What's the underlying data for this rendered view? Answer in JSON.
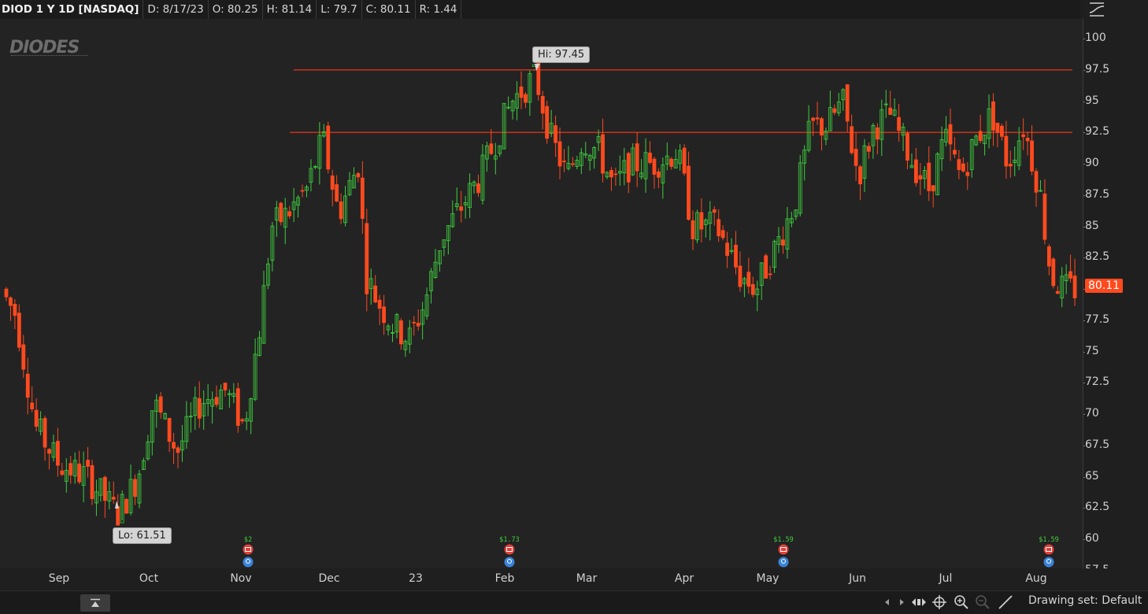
{
  "header": {
    "symbol_label": "DIOD 1 Y 1D [NASDAQ]",
    "date": "D: 8/17/23",
    "open": "O: 80.25",
    "high": "H: 81.14",
    "low": "L: 79.7",
    "close": "C: 80.11",
    "range": "R: 1.44"
  },
  "logo_text": "DIODES",
  "annotations": {
    "high_label": "Hi: 97.45",
    "low_label": "Lo: 61.51"
  },
  "last_price": "80.11",
  "footer": {
    "drawing_set": "Drawing set: Default"
  },
  "icons": [
    "chart-style-icon",
    "collapse-panel-icon",
    "scroll-left-icon",
    "scroll-right-icon",
    "expand-icon",
    "crosshair-icon",
    "zoom-in-icon",
    "zoom-out-icon",
    "drawing-tool-icon",
    "earnings-icon",
    "dividend-icon"
  ],
  "colors": {
    "up": "#3fce3f",
    "down": "#ff4a1e",
    "background": "#232323",
    "resistance_line": "#c8321a"
  },
  "chart_data": {
    "type": "candlestick",
    "title": "DIOD 1 Y 1D [NASDAQ]",
    "x_tick_labels": [
      "Sep",
      "Oct",
      "Nov",
      "Dec",
      "23",
      "Feb",
      "Mar",
      "Apr",
      "May",
      "Jun",
      "Jul",
      "Aug"
    ],
    "y_tick_labels": [
      "100",
      "97.5",
      "95",
      "92.5",
      "90",
      "87.5",
      "85",
      "82.5",
      "80",
      "77.5",
      "75",
      "72.5",
      "70",
      "67.5",
      "65",
      "62.5",
      "60",
      "57.5"
    ],
    "ylim": [
      57.5,
      100
    ],
    "horizontal_lines": [
      97.5,
      92.5
    ],
    "high": 97.45,
    "low": 61.51,
    "last": 80.11,
    "dividend_labels": [
      "$2",
      "$1.73",
      "$1.59",
      "$1.59"
    ],
    "grid": false,
    "series": [
      {
        "name": "Price",
        "approx_close_path": [
          [
            0,
            80
          ],
          [
            20,
            78
          ],
          [
            45,
            69
          ],
          [
            75,
            66
          ],
          [
            110,
            65
          ],
          [
            150,
            62
          ],
          [
            175,
            65
          ],
          [
            195,
            71
          ],
          [
            225,
            67
          ],
          [
            255,
            71
          ],
          [
            285,
            72
          ],
          [
            310,
            69
          ],
          [
            330,
            77
          ],
          [
            345,
            85
          ],
          [
            365,
            86
          ],
          [
            390,
            88
          ],
          [
            410,
            92
          ],
          [
            430,
            86
          ],
          [
            455,
            90
          ],
          [
            465,
            81
          ],
          [
            480,
            79
          ],
          [
            500,
            77
          ],
          [
            520,
            76
          ],
          [
            540,
            79
          ],
          [
            560,
            84
          ],
          [
            580,
            86
          ],
          [
            610,
            89
          ],
          [
            630,
            92
          ],
          [
            650,
            95
          ],
          [
            680,
            97
          ],
          [
            700,
            92
          ],
          [
            720,
            89
          ],
          [
            740,
            92
          ],
          [
            760,
            91
          ],
          [
            780,
            88
          ],
          [
            800,
            90
          ],
          [
            830,
            90
          ],
          [
            860,
            91
          ],
          [
            880,
            85
          ],
          [
            910,
            85
          ],
          [
            940,
            81
          ],
          [
            960,
            80
          ],
          [
            990,
            84
          ],
          [
            1010,
            87
          ],
          [
            1030,
            93
          ],
          [
            1050,
            93
          ],
          [
            1070,
            95
          ],
          [
            1090,
            89
          ],
          [
            1110,
            93
          ],
          [
            1130,
            94
          ],
          [
            1160,
            90
          ],
          [
            1180,
            88
          ],
          [
            1200,
            92
          ],
          [
            1220,
            89
          ],
          [
            1240,
            92
          ],
          [
            1260,
            94
          ],
          [
            1280,
            90
          ],
          [
            1300,
            93
          ],
          [
            1320,
            88
          ],
          [
            1335,
            81
          ],
          [
            1350,
            80
          ],
          [
            1370,
            80
          ]
        ]
      }
    ]
  }
}
